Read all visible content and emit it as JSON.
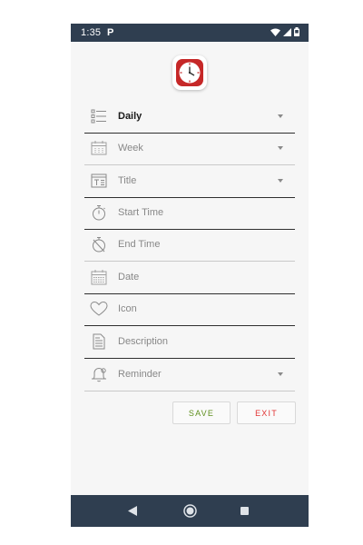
{
  "status_bar": {
    "time": "1:35",
    "p_label": "P",
    "icons": [
      "wifi-icon",
      "signal-icon",
      "battery-icon"
    ]
  },
  "app": {
    "logo": "clock-icon",
    "accent": "#c62828"
  },
  "form": {
    "fields": [
      {
        "label": "Daily",
        "icon": "list-icon",
        "dropdown": true,
        "active": true
      },
      {
        "label": "Week",
        "icon": "calendar-week-icon",
        "dropdown": true,
        "active": false
      },
      {
        "label": "Title",
        "icon": "title-icon",
        "dropdown": true,
        "active": false
      },
      {
        "label": "Start Time",
        "icon": "stopwatch-icon",
        "dropdown": false,
        "active": false
      },
      {
        "label": "End Time",
        "icon": "stopwatch-off-icon",
        "dropdown": false,
        "active": false
      },
      {
        "label": "Date",
        "icon": "calendar-icon",
        "dropdown": false,
        "active": false
      },
      {
        "label": "Icon",
        "icon": "heart-icon",
        "dropdown": false,
        "active": false
      },
      {
        "label": "Description",
        "icon": "document-icon",
        "dropdown": false,
        "active": false
      },
      {
        "label": "Reminder",
        "icon": "bell-icon",
        "dropdown": true,
        "active": false
      }
    ]
  },
  "buttons": {
    "save": "SAVE",
    "exit": "EXIT"
  },
  "colors": {
    "bar": "#2f3e50",
    "background": "#f6f6f6",
    "save_text": "#5f8f1e",
    "exit_text": "#e23434"
  }
}
